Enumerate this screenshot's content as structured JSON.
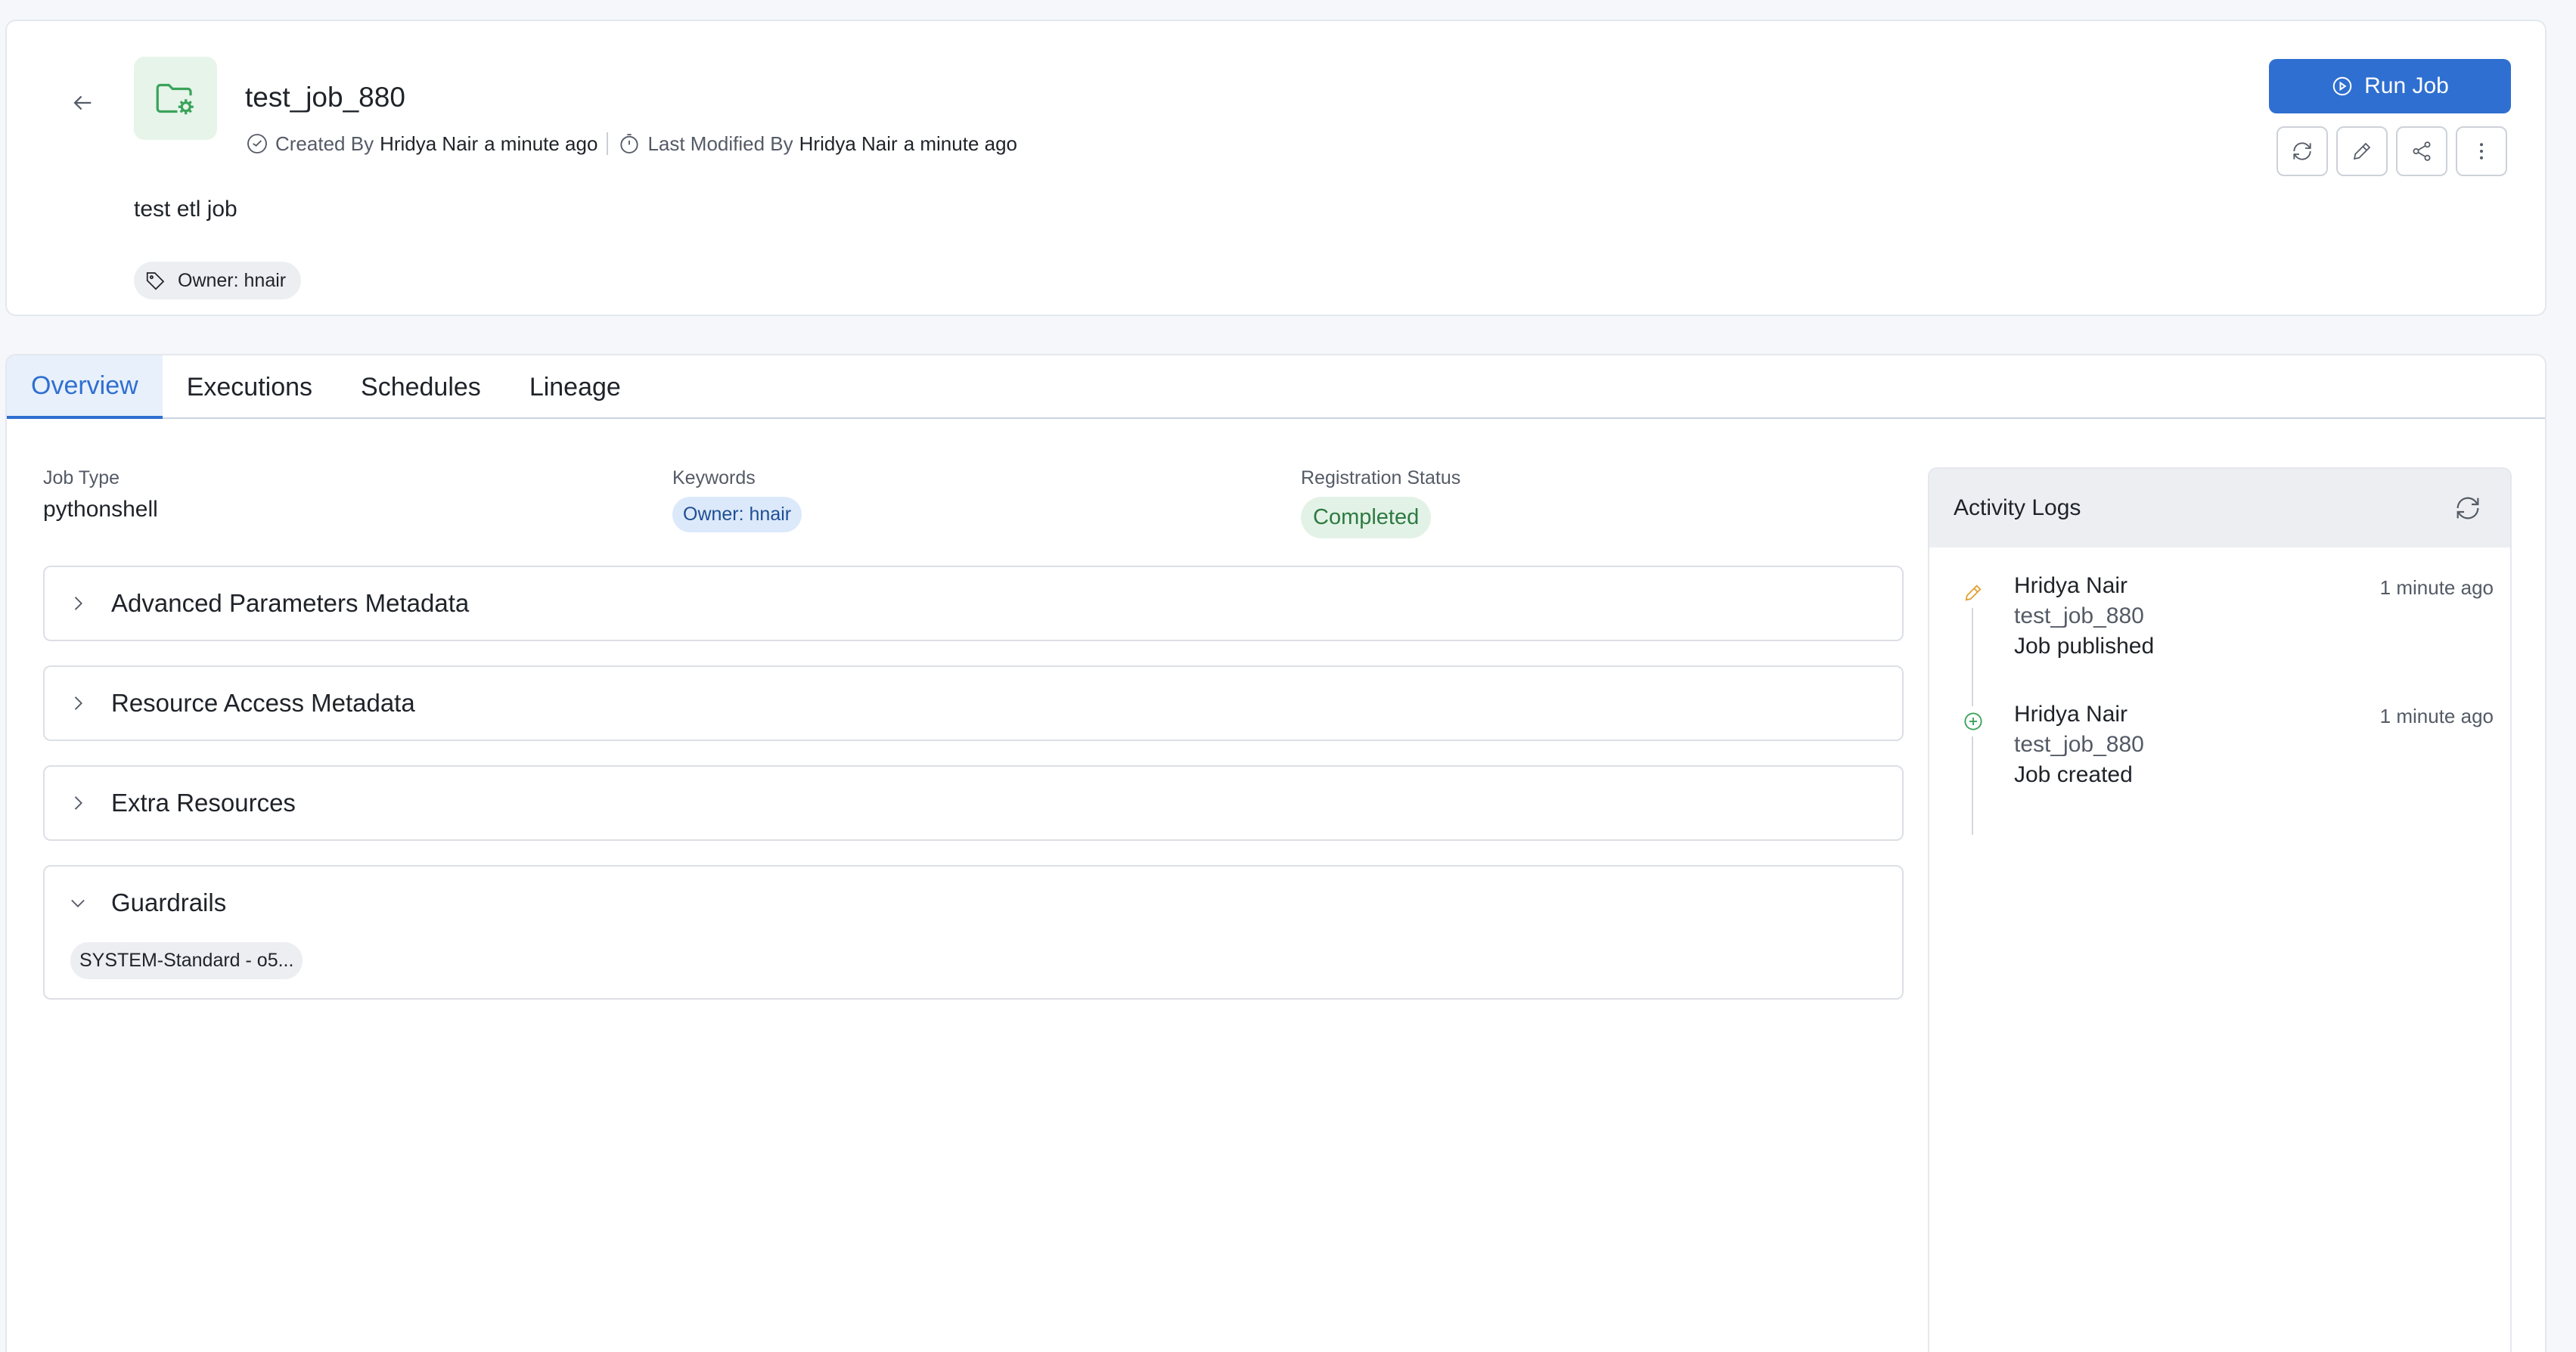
{
  "header": {
    "title": "test_job_880",
    "created_label": "Created By",
    "created_by": "Hridya Nair",
    "created_when": "a minute ago",
    "modified_label": "Last Modified By",
    "modified_by": "Hridya Nair",
    "modified_when": "a minute ago",
    "description": "test etl job",
    "owner_chip": "Owner: hnair",
    "run_label": "Run Job",
    "icons": [
      "arrow-left-icon",
      "folder-gear-icon",
      "clock-icon",
      "timer-icon",
      "tag-icon",
      "play-circle-icon",
      "refresh-icon",
      "pencil-icon",
      "share-icon",
      "more-vertical-icon"
    ]
  },
  "tabs": [
    {
      "label": "Overview",
      "active": true
    },
    {
      "label": "Executions",
      "active": false
    },
    {
      "label": "Schedules",
      "active": false
    },
    {
      "label": "Lineage",
      "active": false
    }
  ],
  "overview": {
    "job_type_label": "Job Type",
    "job_type": "pythonshell",
    "keywords_label": "Keywords",
    "keyword": "Owner: hnair",
    "status_label": "Registration Status",
    "status": "Completed"
  },
  "sections": [
    {
      "title": "Advanced Parameters Metadata",
      "expanded": false
    },
    {
      "title": "Resource Access Metadata",
      "expanded": false
    },
    {
      "title": "Extra Resources",
      "expanded": false
    },
    {
      "title": "Guardrails",
      "expanded": true
    }
  ],
  "guardrails": {
    "chip": "SYSTEM-Standard - o5..."
  },
  "activity": {
    "title": "Activity Logs",
    "logs": [
      {
        "user": "Hridya Nair",
        "time": "1 minute ago",
        "item": "test_job_880",
        "action": "Job published",
        "icon": "pencil-icon"
      },
      {
        "user": "Hridya Nair",
        "time": "1 minute ago",
        "item": "test_job_880",
        "action": "Job created",
        "icon": "plus-circle-icon"
      }
    ]
  },
  "colors": {
    "accent": "#2f6fd1",
    "success": "#2d7a43",
    "edit": "#e0a030",
    "create": "#3aa35a"
  }
}
